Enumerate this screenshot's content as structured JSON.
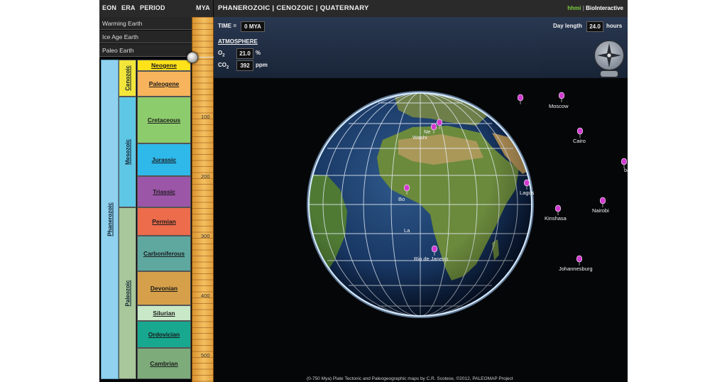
{
  "timeline": {
    "headers": {
      "eon": "EON",
      "era": "ERA",
      "period": "PERIOD",
      "mya": "MYA"
    },
    "menu": [
      "Warming Earth",
      "Ice Age Earth",
      "Paleo Earth"
    ],
    "eon": "Phanerozoic",
    "eras": [
      "Cenozoic",
      "Mesozoic",
      "Paleozoic"
    ],
    "periods": [
      "Neogene",
      "Paleogene",
      "Cretaceous",
      "Jurassic",
      "Triassic",
      "Permian",
      "Carboniferous",
      "Devonian",
      "Silurian",
      "Ordovician",
      "Cambrian"
    ],
    "ticks": [
      "100",
      "200",
      "300",
      "400",
      "500"
    ],
    "colors": {
      "eon": "#8fd1ee",
      "cenozoic": "#f2e63a",
      "mesozoic": "#5fc7e6",
      "paleozoic": "#a8c79a",
      "neogene": "#ffe21a",
      "paleogene": "#f8b45c",
      "cretaceous": "#8dcc6c",
      "jurassic": "#2fb8ea",
      "triassic": "#9c56a8",
      "permian": "#ec6c4c",
      "carboniferous": "#5ea8a0",
      "devonian": "#d6a04a",
      "silurian": "#c8e8c8",
      "ordovician": "#18a890",
      "cambrian": "#7dab7a"
    }
  },
  "header": {
    "title": "PHANEROZOIC | CENOZOIC | QUATERNARY",
    "brand_hhmi": "hhmi",
    "brand_name": "BioInteractive"
  },
  "info": {
    "time_label": "TIME =",
    "time_value": "0 MYA",
    "day_label": "Day length",
    "day_value": "24.0",
    "day_unit": "hours",
    "atmosphere": "ATMOSPHERE",
    "o2_label": "O",
    "o2_sub": "2",
    "o2_value": "21.0",
    "o2_unit": "%",
    "co2_label": "CO",
    "co2_sub": "2",
    "co2_value": "392",
    "co2_unit": "ppm"
  },
  "cities": [
    "Moscow",
    "Cairo",
    "Lagos",
    "Nairobi",
    "Kinshasa",
    "Johannesburg",
    "Rio de Janeiro",
    "Washi",
    "Bo",
    "La",
    "bai",
    "Ne"
  ],
  "footer": "(0-750 Mya) Plate Tectonic and Paleogeographic maps by C.R. Scotese, ©2012, PALEOMAP Project",
  "accent": {
    "pin": "#d23ad0",
    "ocean": "#1b3a66",
    "land": "#5f7f3a",
    "panel": "#2b3b55"
  }
}
